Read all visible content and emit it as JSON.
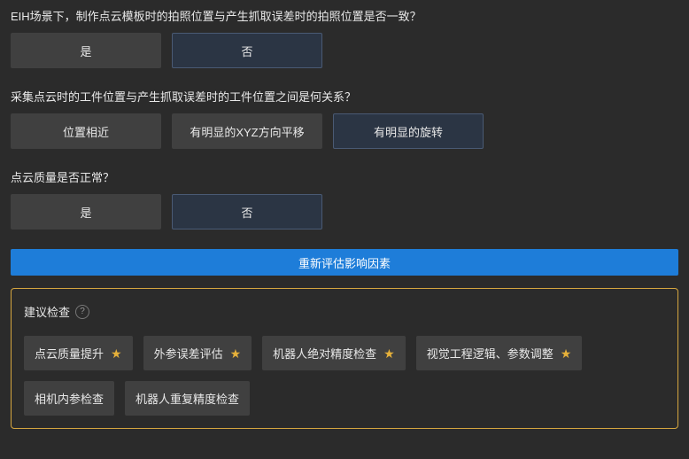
{
  "questions": [
    {
      "text": "EIH场景下，制作点云模板时的拍照位置与产生抓取误差时的拍照位置是否一致？",
      "options": [
        {
          "label": "是",
          "selected": false
        },
        {
          "label": "否",
          "selected": true
        }
      ]
    },
    {
      "text": "采集点云时的工件位置与产生抓取误差时的工件位置之间是何关系？",
      "options": [
        {
          "label": "位置相近",
          "selected": false
        },
        {
          "label": "有明显的XYZ方向平移",
          "selected": false
        },
        {
          "label": "有明显的旋转",
          "selected": true
        }
      ]
    },
    {
      "text": "点云质量是否正常？",
      "options": [
        {
          "label": "是",
          "selected": false
        },
        {
          "label": "否",
          "selected": true
        }
      ]
    }
  ],
  "reassess_label": "重新评估影响因素",
  "suggest": {
    "title": "建议检查",
    "help_symbol": "?",
    "items": [
      {
        "label": "点云质量提升",
        "starred": true
      },
      {
        "label": "外参误差评估",
        "starred": true
      },
      {
        "label": "机器人绝对精度检查",
        "starred": true
      },
      {
        "label": "视觉工程逻辑、参数调整",
        "starred": true
      },
      {
        "label": "相机内参检查",
        "starred": false
      },
      {
        "label": "机器人重复精度检查",
        "starred": false
      }
    ]
  },
  "icons": {
    "star": "★"
  }
}
